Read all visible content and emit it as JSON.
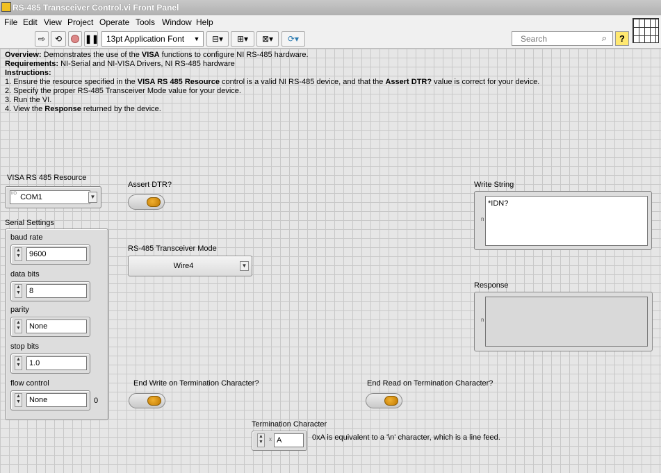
{
  "window": {
    "title": "RS-485 Transceiver Control.vi Front Panel"
  },
  "menu": [
    "File",
    "Edit",
    "View",
    "Project",
    "Operate",
    "Tools",
    "Window",
    "Help"
  ],
  "toolbar": {
    "font_label": "13pt Application Font",
    "search_placeholder": "Search",
    "help_label": "?"
  },
  "documentation": {
    "overview_label": "Overview:",
    "overview_pre": " Demonstrates the use of the ",
    "overview_bold": "VISA",
    "overview_post": " functions to configure NI RS-485 hardware.",
    "requirements_label": "Requirements:",
    "requirements_text": " NI-Serial and NI-VISA Drivers, NI RS-485 hardware",
    "instructions_label": "Instructions:",
    "step1_pre": "1. Ensure the resource specified in the ",
    "step1_bold1": "VISA RS 485 Resource",
    "step1_mid": " control is a valid NI RS-485 device, and that the ",
    "step1_bold2": "Assert DTR?",
    "step1_post": " value is correct for your device.",
    "step2": "2. Specify the proper RS-485 Transceiver Mode value for your device.",
    "step3": "3. Run the VI.",
    "step4_pre": "4. View the ",
    "step4_bold": "Response",
    "step4_post": " returned by the device."
  },
  "controls": {
    "visa_resource": {
      "label": "VISA RS 485 Resource",
      "value": "COM1",
      "io_glyph": "I/O"
    },
    "assert_dtr": {
      "label": "Assert DTR?"
    },
    "serial_settings": {
      "label": "Serial Settings",
      "baud_rate": {
        "label": "baud rate",
        "value": "9600"
      },
      "data_bits": {
        "label": "data bits",
        "value": "8"
      },
      "parity": {
        "label": "parity",
        "value": "None"
      },
      "stop_bits": {
        "label": "stop bits",
        "value": "1.0"
      },
      "flow_control": {
        "label": "flow control",
        "value": "None",
        "index": "0"
      }
    },
    "transceiver_mode": {
      "label": "RS-485 Transceiver Mode",
      "value": "Wire4"
    },
    "write_string": {
      "label": "Write String",
      "value": "*IDN?",
      "display_glyph": "n"
    },
    "response": {
      "label": "Response",
      "value": "",
      "display_glyph": "n"
    },
    "end_write": {
      "label": "End Write on Termination Character?"
    },
    "end_read": {
      "label": "End Read on Termination Character?"
    },
    "termination_char": {
      "label": "Termination Character",
      "value": "A",
      "radix": "x",
      "note": "0xA is equivalent to a '\\n' character, which is a line feed."
    }
  },
  "colors": {
    "led_on": "#e0a020",
    "panel_bg": "#e6e6e6"
  }
}
